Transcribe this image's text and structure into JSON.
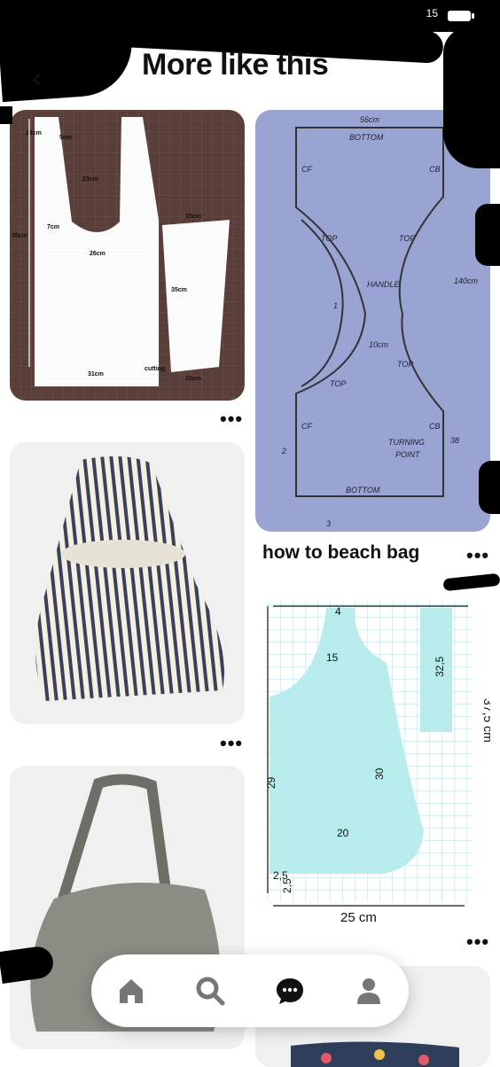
{
  "page": {
    "title": "More like this"
  },
  "status_bar": {
    "text": "15"
  },
  "pins": [
    {
      "id": "bag-pattern-brown",
      "labels": [
        "24cm",
        "5cm",
        "23cm",
        "35cm",
        "7cm",
        "15cm",
        "26cm",
        "35cm",
        "31cm",
        "cutting",
        "10cm"
      ]
    },
    {
      "id": "bag-pattern-blue",
      "title": "how to beach bag",
      "labels": [
        "56cm",
        "BOTTOM",
        "CF",
        "CB",
        "TOP",
        "TOP",
        "HANDLE",
        "1",
        "10cm",
        "140cm",
        "TOP",
        "TOP",
        "CF",
        "CB",
        "2",
        "TURNING",
        "POINT",
        "38",
        "BOTTOM",
        "3"
      ]
    },
    {
      "id": "striped-bag"
    },
    {
      "id": "bag-pattern-grid",
      "labels": [
        "4",
        "15",
        "32,5",
        "37,5 cm",
        "30",
        "29",
        "20",
        "2,5",
        "2,5",
        "25 cm"
      ]
    },
    {
      "id": "gray-bag"
    },
    {
      "id": "floral-bag"
    }
  ],
  "more_label": "•••",
  "nav": [
    {
      "name": "home",
      "icon": "home-icon"
    },
    {
      "name": "search",
      "icon": "search-icon"
    },
    {
      "name": "messages",
      "icon": "chat-bubble-icon"
    },
    {
      "name": "profile",
      "icon": "person-icon"
    }
  ],
  "colors": {
    "brown_mat": "#5a3e3a",
    "blue_paper": "#9aa4d3",
    "grid_fill": "#b8ecec",
    "accent_text": "#111111"
  }
}
